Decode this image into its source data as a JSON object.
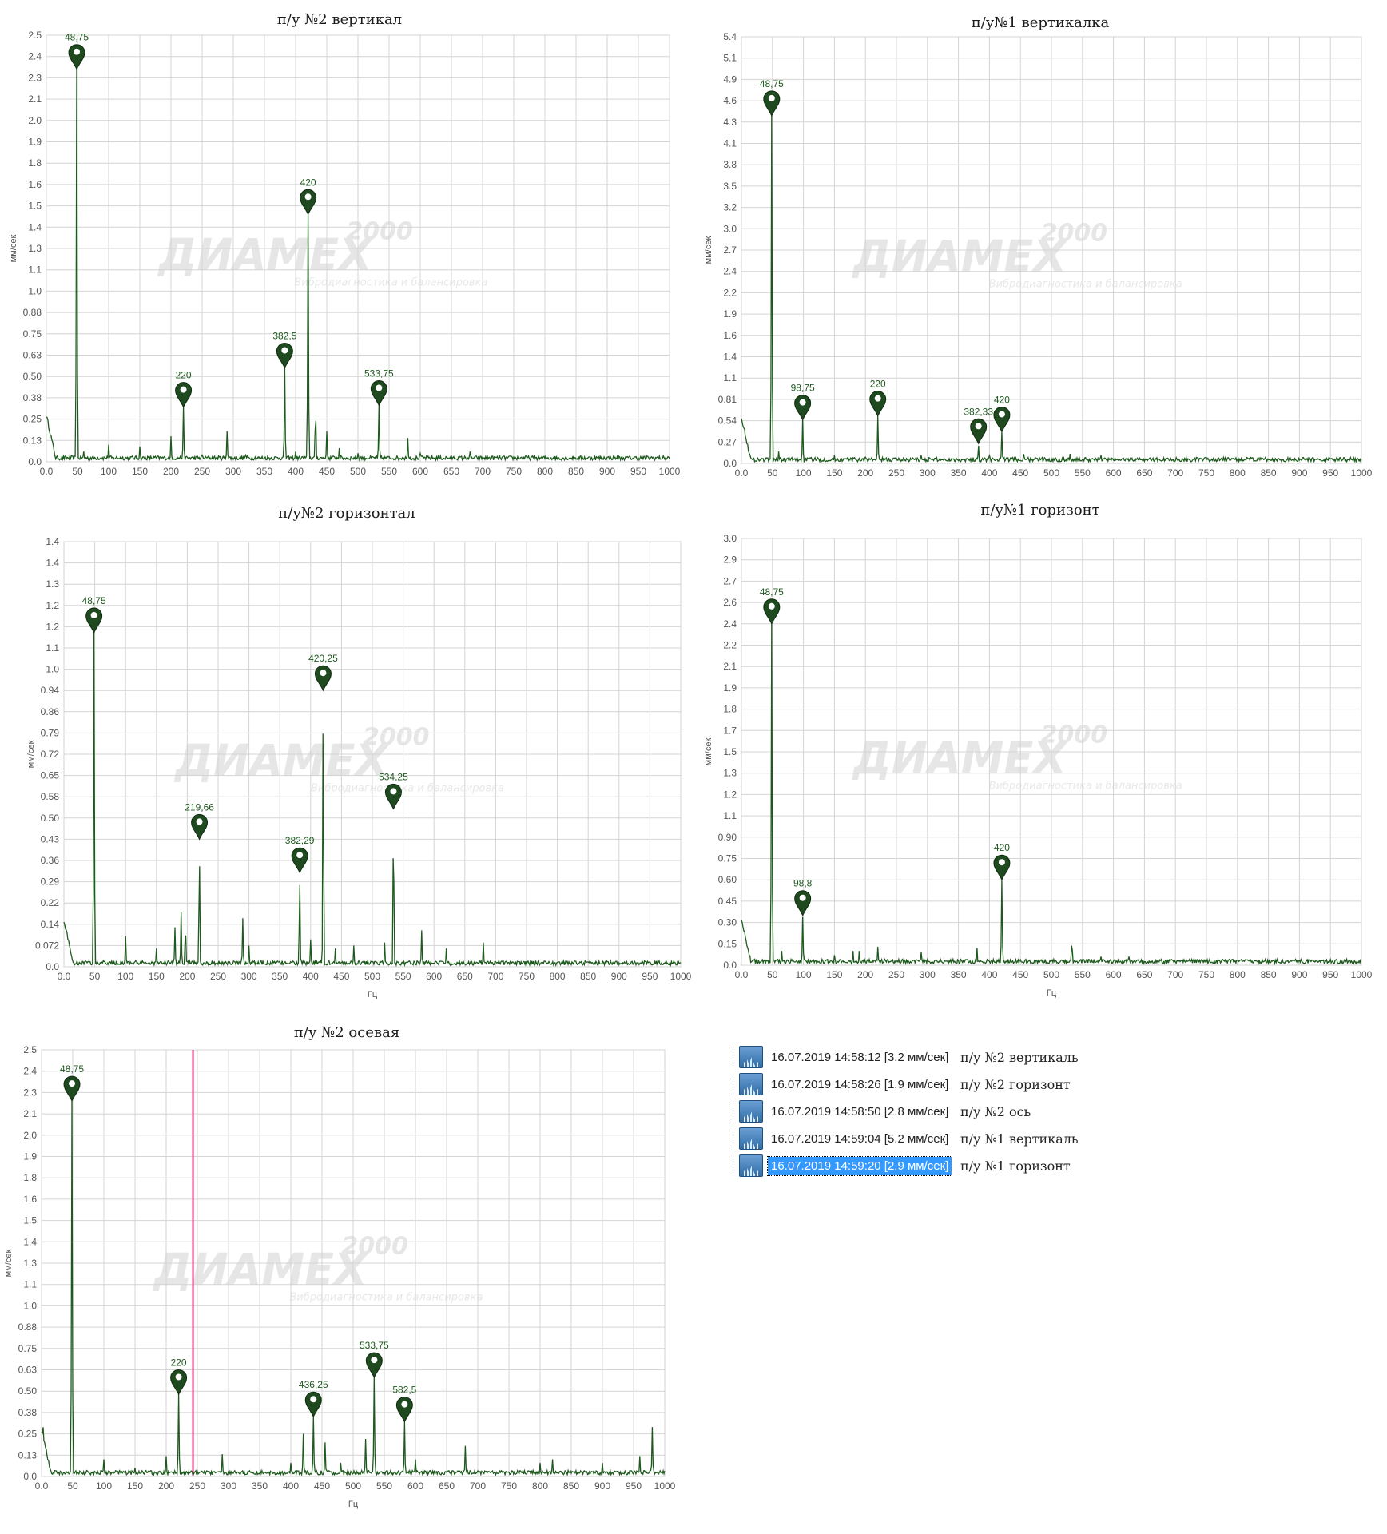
{
  "ylabel": "мм/сек",
  "watermark": {
    "big": "ДИАМЕХ",
    "num": "2000",
    "sub": "Вибродиагностика и балансировка"
  },
  "chart_data": [
    {
      "id": "c1",
      "type": "line",
      "title": "п/у №2 вертикал",
      "xlabel": "",
      "xlim": [
        0,
        1000
      ],
      "xticks": [
        0,
        50,
        100,
        150,
        200,
        250,
        300,
        350,
        400,
        450,
        500,
        550,
        600,
        650,
        700,
        750,
        800,
        850,
        900,
        950,
        1000
      ],
      "xtick_labels": [
        "0.0",
        "50",
        "100",
        "150",
        "200",
        "250",
        "300",
        "350",
        "400",
        "450",
        "500",
        "550",
        "600",
        "650",
        "700",
        "750",
        "800",
        "850",
        "900",
        "950",
        "1000"
      ],
      "ylim": [
        0,
        2.5
      ],
      "yticks": [
        0.0,
        0.13,
        0.25,
        0.38,
        0.5,
        0.63,
        0.75,
        0.88,
        1.0,
        1.1,
        1.3,
        1.4,
        1.5,
        1.6,
        1.8,
        1.9,
        2.0,
        2.1,
        2.3,
        2.4,
        2.5
      ],
      "ytick_labels": [
        "0.0",
        "0.13",
        "0.25",
        "0.38",
        "0.50",
        "0.63",
        "0.75",
        "0.88",
        "1.0",
        "1.1",
        "1.3",
        "1.4",
        "1.5",
        "1.6",
        "1.8",
        "1.9",
        "2.0",
        "2.1",
        "2.3",
        "2.4",
        "2.5"
      ],
      "peaks": [
        [
          48.75,
          2.3
        ],
        [
          60,
          0.06
        ],
        [
          100,
          0.1
        ],
        [
          150,
          0.09
        ],
        [
          200,
          0.15
        ],
        [
          220,
          0.32
        ],
        [
          250,
          0.04
        ],
        [
          290,
          0.18
        ],
        [
          320,
          0.04
        ],
        [
          382.5,
          0.55
        ],
        [
          400,
          0.06
        ],
        [
          420,
          1.45
        ],
        [
          432,
          0.35
        ],
        [
          450,
          0.18
        ],
        [
          470,
          0.08
        ],
        [
          500,
          0.05
        ],
        [
          533.75,
          0.33
        ],
        [
          580,
          0.14
        ],
        [
          600,
          0.05
        ],
        [
          680,
          0.06
        ]
      ],
      "markers": [
        {
          "x": 48.75,
          "y": 2.3,
          "label": "48,75"
        },
        {
          "x": 220,
          "y": 0.32,
          "label": "220"
        },
        {
          "x": 382.5,
          "y": 0.55,
          "label": "382,5"
        },
        {
          "x": 420,
          "y": 1.45,
          "label": "420"
        },
        {
          "x": 533.75,
          "y": 0.33,
          "label": "533,75"
        }
      ]
    },
    {
      "id": "c2",
      "type": "line",
      "title": "п/у№1 вертикалка",
      "xlabel": "",
      "xlim": [
        0,
        1000
      ],
      "xticks": [
        0,
        50,
        100,
        150,
        200,
        250,
        300,
        350,
        400,
        450,
        500,
        550,
        600,
        650,
        700,
        750,
        800,
        850,
        900,
        950,
        1000
      ],
      "xtick_labels": [
        "0.0",
        "50",
        "100",
        "150",
        "200",
        "250",
        "300",
        "350",
        "400",
        "450",
        "500",
        "550",
        "600",
        "650",
        "700",
        "750",
        "800",
        "850",
        "900",
        "950",
        "1000"
      ],
      "ylim": [
        0,
        5.4
      ],
      "yticks": [
        0.0,
        0.27,
        0.54,
        0.81,
        1.1,
        1.4,
        1.6,
        1.9,
        2.2,
        2.4,
        2.7,
        3.0,
        3.2,
        3.5,
        3.8,
        4.1,
        4.3,
        4.6,
        4.9,
        5.1,
        5.4
      ],
      "ytick_labels": [
        "0.0",
        "0.27",
        "0.54",
        "0.81",
        "1.1",
        "1.4",
        "1.6",
        "1.9",
        "2.2",
        "2.4",
        "2.7",
        "3.0",
        "3.2",
        "3.5",
        "3.8",
        "4.1",
        "4.3",
        "4.6",
        "4.9",
        "5.1",
        "5.4"
      ],
      "peaks": [
        [
          48.75,
          4.4
        ],
        [
          60,
          0.15
        ],
        [
          98.75,
          0.55
        ],
        [
          150,
          0.1
        ],
        [
          200,
          0.08
        ],
        [
          220,
          0.6
        ],
        [
          290,
          0.1
        ],
        [
          382.33,
          0.25
        ],
        [
          400,
          0.1
        ],
        [
          420,
          0.4
        ],
        [
          455,
          0.12
        ],
        [
          530,
          0.12
        ],
        [
          580,
          0.1
        ],
        [
          620,
          0.06
        ],
        [
          680,
          0.03
        ]
      ],
      "markers": [
        {
          "x": 48.75,
          "y": 4.4,
          "label": "48,75"
        },
        {
          "x": 98.75,
          "y": 0.55,
          "label": "98,75"
        },
        {
          "x": 220,
          "y": 0.6,
          "label": "220"
        },
        {
          "x": 382.33,
          "y": 0.25,
          "label": "382,33"
        },
        {
          "x": 420,
          "y": 0.4,
          "label": "420"
        }
      ]
    },
    {
      "id": "c3",
      "type": "line",
      "title": "п/у№2 горизонтал",
      "xlabel": "Гц",
      "xlim": [
        0,
        1000
      ],
      "xticks": [
        0,
        50,
        100,
        150,
        200,
        250,
        300,
        350,
        400,
        450,
        500,
        550,
        600,
        650,
        700,
        750,
        800,
        850,
        900,
        950,
        1000
      ],
      "xtick_labels": [
        "0.0",
        "50",
        "100",
        "150",
        "200",
        "250",
        "300",
        "350",
        "400",
        "450",
        "500",
        "550",
        "600",
        "650",
        "700",
        "750",
        "800",
        "850",
        "900",
        "950",
        "1000"
      ],
      "ylim": [
        0,
        1.4
      ],
      "yticks": [
        0.0,
        0.072,
        0.14,
        0.22,
        0.29,
        0.36,
        0.43,
        0.5,
        0.58,
        0.65,
        0.72,
        0.79,
        0.86,
        0.94,
        1.0,
        1.1,
        1.2,
        1.2,
        1.3,
        1.4,
        1.4
      ],
      "ytick_labels": [
        "0.0",
        "0.072",
        "0.14",
        "0.22",
        "0.29",
        "0.36",
        "0.43",
        "0.50",
        "0.58",
        "0.65",
        "0.72",
        "0.79",
        "0.86",
        "0.94",
        "1.0",
        "1.1",
        "1.2",
        "1.2",
        "1.3",
        "1.4",
        "1.4"
      ],
      "peaks": [
        [
          48.75,
          1.1
        ],
        [
          100,
          0.1
        ],
        [
          150,
          0.06
        ],
        [
          180,
          0.13
        ],
        [
          190,
          0.18
        ],
        [
          197,
          0.15
        ],
        [
          219.66,
          0.42
        ],
        [
          290,
          0.16
        ],
        [
          300,
          0.07
        ],
        [
          382.29,
          0.31
        ],
        [
          400,
          0.09
        ],
        [
          420.25,
          0.91
        ],
        [
          440,
          0.06
        ],
        [
          470,
          0.07
        ],
        [
          520,
          0.08
        ],
        [
          534.25,
          0.52
        ],
        [
          580,
          0.12
        ],
        [
          620,
          0.06
        ],
        [
          680,
          0.08
        ]
      ],
      "markers": [
        {
          "x": 48.75,
          "y": 1.1,
          "label": "48,75"
        },
        {
          "x": 219.66,
          "y": 0.42,
          "label": "219,66"
        },
        {
          "x": 382.29,
          "y": 0.31,
          "label": "382,29"
        },
        {
          "x": 420.25,
          "y": 0.91,
          "label": "420,25"
        },
        {
          "x": 534.25,
          "y": 0.52,
          "label": "534,25"
        }
      ]
    },
    {
      "id": "c4",
      "type": "line",
      "title": "п/у№1 горизонт",
      "xlabel": "Гц",
      "xlim": [
        0,
        1000
      ],
      "xticks": [
        0,
        50,
        100,
        150,
        200,
        250,
        300,
        350,
        400,
        450,
        500,
        550,
        600,
        650,
        700,
        750,
        800,
        850,
        900,
        950,
        1000
      ],
      "xtick_labels": [
        "0.0",
        "50",
        "100",
        "150",
        "200",
        "250",
        "300",
        "350",
        "400",
        "450",
        "500",
        "550",
        "600",
        "650",
        "700",
        "750",
        "800",
        "850",
        "900",
        "950",
        "1000"
      ],
      "ylim": [
        0,
        3.0
      ],
      "yticks": [
        0.0,
        0.15,
        0.3,
        0.45,
        0.6,
        0.75,
        0.9,
        1.1,
        1.2,
        1.3,
        1.5,
        1.7,
        1.8,
        1.9,
        2.1,
        2.2,
        2.4,
        2.6,
        2.7,
        2.9,
        3.0
      ],
      "ytick_labels": [
        "0.0",
        "0.15",
        "0.30",
        "0.45",
        "0.60",
        "0.75",
        "0.90",
        "1.1",
        "1.2",
        "1.3",
        "1.5",
        "1.7",
        "1.8",
        "1.9",
        "2.1",
        "2.2",
        "2.4",
        "2.6",
        "2.7",
        "2.9",
        "3.0"
      ],
      "peaks": [
        [
          48.75,
          2.4
        ],
        [
          65,
          0.1
        ],
        [
          98.8,
          0.35
        ],
        [
          150,
          0.07
        ],
        [
          180,
          0.1
        ],
        [
          190,
          0.1
        ],
        [
          220,
          0.13
        ],
        [
          290,
          0.09
        ],
        [
          380,
          0.12
        ],
        [
          420,
          0.6
        ],
        [
          533,
          0.2
        ],
        [
          580,
          0.06
        ],
        [
          625,
          0.06
        ],
        [
          780,
          0.03
        ],
        [
          840,
          0.04
        ]
      ],
      "markers": [
        {
          "x": 48.75,
          "y": 2.4,
          "label": "48,75"
        },
        {
          "x": 98.8,
          "y": 0.35,
          "label": "98,8"
        },
        {
          "x": 420,
          "y": 0.6,
          "label": "420"
        }
      ]
    },
    {
      "id": "c5",
      "type": "line",
      "title": "п/у №2 осевая",
      "xlabel": "Гц",
      "xlim": [
        0,
        1000
      ],
      "xticks": [
        0,
        50,
        100,
        150,
        200,
        250,
        300,
        350,
        400,
        450,
        500,
        550,
        600,
        650,
        700,
        750,
        800,
        850,
        900,
        950,
        1000
      ],
      "xtick_labels": [
        "0.0",
        "50",
        "100",
        "150",
        "200",
        "250",
        "300",
        "350",
        "400",
        "450",
        "500",
        "550",
        "600",
        "650",
        "700",
        "750",
        "800",
        "850",
        "900",
        "950",
        "1000"
      ],
      "ylim": [
        0,
        2.5
      ],
      "yticks": [
        0.0,
        0.13,
        0.25,
        0.38,
        0.5,
        0.63,
        0.75,
        0.88,
        1.0,
        1.1,
        1.3,
        1.4,
        1.5,
        1.6,
        1.8,
        1.9,
        2.0,
        2.1,
        2.3,
        2.4,
        2.5
      ],
      "ytick_labels": [
        "0.0",
        "0.13",
        "0.25",
        "0.38",
        "0.50",
        "0.63",
        "0.75",
        "0.88",
        "1.0",
        "1.1",
        "1.3",
        "1.4",
        "1.5",
        "1.6",
        "1.8",
        "1.9",
        "2.0",
        "2.1",
        "2.3",
        "2.4",
        "2.5"
      ],
      "cursor_x": 243,
      "peaks": [
        [
          2,
          0.42
        ],
        [
          48.75,
          2.2
        ],
        [
          100,
          0.1
        ],
        [
          150,
          0.05
        ],
        [
          200,
          0.12
        ],
        [
          220,
          0.48
        ],
        [
          290,
          0.13
        ],
        [
          400,
          0.08
        ],
        [
          420,
          0.25
        ],
        [
          436.25,
          0.35
        ],
        [
          455,
          0.2
        ],
        [
          480,
          0.08
        ],
        [
          520,
          0.22
        ],
        [
          533.75,
          0.58
        ],
        [
          582.5,
          0.32
        ],
        [
          600,
          0.1
        ],
        [
          680,
          0.18
        ],
        [
          800,
          0.08
        ],
        [
          820,
          0.1
        ],
        [
          900,
          0.08
        ],
        [
          960,
          0.12
        ],
        [
          980,
          0.29
        ]
      ],
      "markers": [
        {
          "x": 48.75,
          "y": 2.2,
          "label": "48,75"
        },
        {
          "x": 220,
          "y": 0.48,
          "label": "220"
        },
        {
          "x": 436.25,
          "y": 0.35,
          "label": "436,25"
        },
        {
          "x": 533.75,
          "y": 0.58,
          "label": "533,75"
        },
        {
          "x": 582.5,
          "y": 0.32,
          "label": "582,5"
        }
      ]
    }
  ],
  "measurements": {
    "rows": [
      {
        "text": "16.07.2019 14:58:12 [3.2 мм/сек]",
        "desc": "п/у №2 вертикаль",
        "selected": false
      },
      {
        "text": "16.07.2019 14:58:26 [1.9 мм/сек]",
        "desc": "п/у №2 горизонт",
        "selected": false
      },
      {
        "text": "16.07.2019 14:58:50 [2.8 мм/сек]",
        "desc": "п/у №2 ось",
        "selected": false
      },
      {
        "text": "16.07.2019 14:59:04 [5.2 мм/сек]",
        "desc": "п/у №1 вертикаль",
        "selected": false
      },
      {
        "text": "16.07.2019 14:59:20 [2.9 мм/сек]",
        "desc": "п/у №1 горизонт",
        "selected": true
      }
    ]
  }
}
